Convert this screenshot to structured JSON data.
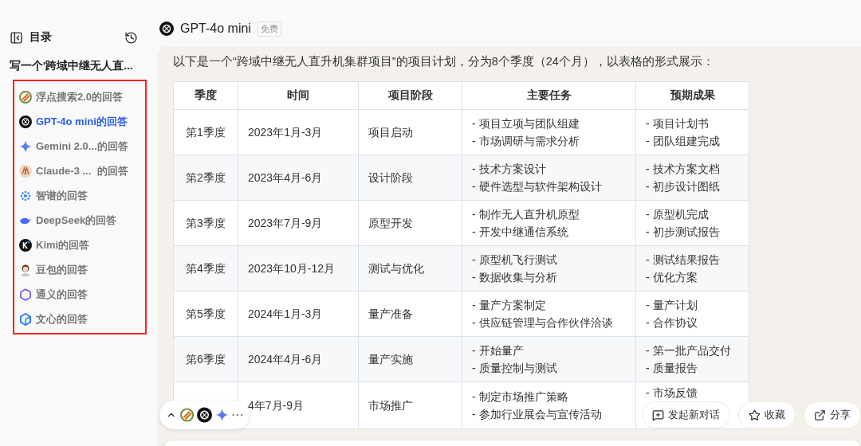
{
  "sidebar": {
    "title": "目录",
    "question": "写一个'跨域中继无人直...",
    "items": [
      {
        "label": "浮点搜索2.0的回答",
        "selected": false
      },
      {
        "label": "GPT-4o mini的回答",
        "selected": true
      },
      {
        "label": "Gemini 2.0...的回答",
        "selected": false
      },
      {
        "label": "Claude-3 ...  的回答",
        "selected": false
      },
      {
        "label": "智谱的回答",
        "selected": false
      },
      {
        "label": "DeepSeek的回答",
        "selected": false
      },
      {
        "label": "Kimi的回答",
        "selected": false
      },
      {
        "label": "豆包的回答",
        "selected": false
      },
      {
        "label": "通义的回答",
        "selected": false
      },
      {
        "label": "文心的回答",
        "selected": false
      }
    ]
  },
  "answer": {
    "model": "GPT-4o mini",
    "badge": "免费",
    "intro": "以下是一个“跨域中继无人直升机集群项目”的项目计划，分为8个季度（24个月），以表格的形式展示：",
    "table": {
      "columns": [
        "季度",
        "时间",
        "项目阶段",
        "主要任务",
        "预期成果"
      ],
      "rows": [
        {
          "quarter": "第1季度",
          "time": "2023年1月-3月",
          "phase": "项目启动",
          "tasks": [
            "- 项目立项与团队组建",
            "- 市场调研与需求分析"
          ],
          "results": [
            "- 项目计划书",
            "- 团队组建完成"
          ]
        },
        {
          "quarter": "第2季度",
          "time": "2023年4月-6月",
          "phase": "设计阶段",
          "tasks": [
            "- 技术方案设计",
            "- 硬件选型与软件架构设计"
          ],
          "results": [
            "- 技术方案文档",
            "- 初步设计图纸"
          ]
        },
        {
          "quarter": "第3季度",
          "time": "2023年7月-9月",
          "phase": "原型开发",
          "tasks": [
            "- 制作无人直升机原型",
            "- 开发中继通信系统"
          ],
          "results": [
            "- 原型机完成",
            "- 初步测试报告"
          ]
        },
        {
          "quarter": "第4季度",
          "time": "2023年10月-12月",
          "phase": "测试与优化",
          "tasks": [
            "- 原型机飞行测试",
            "- 数据收集与分析"
          ],
          "results": [
            "- 测试结果报告",
            "- 优化方案"
          ]
        },
        {
          "quarter": "第5季度",
          "time": "2024年1月-3月",
          "phase": "量产准备",
          "tasks": [
            "- 量产方案制定",
            "- 供应链管理与合作伙伴洽谈"
          ],
          "results": [
            "- 量产计划",
            "- 合作协议"
          ]
        },
        {
          "quarter": "第6季度",
          "time": "2024年4月-6月",
          "phase": "量产实施",
          "tasks": [
            "- 开始量产",
            "- 质量控制与测试"
          ],
          "results": [
            "- 第一批产品交付",
            "- 质量报告"
          ]
        },
        {
          "time": "4年7月-9月",
          "phase": "市场推广",
          "tasks": [
            "- 制定市场推广策略",
            "- 参加行业展会与宣传活动"
          ],
          "results": [
            "- 市场反馈"
          ]
        }
      ]
    }
  },
  "actions": [
    "发起新对话",
    "收藏",
    "分享"
  ]
}
